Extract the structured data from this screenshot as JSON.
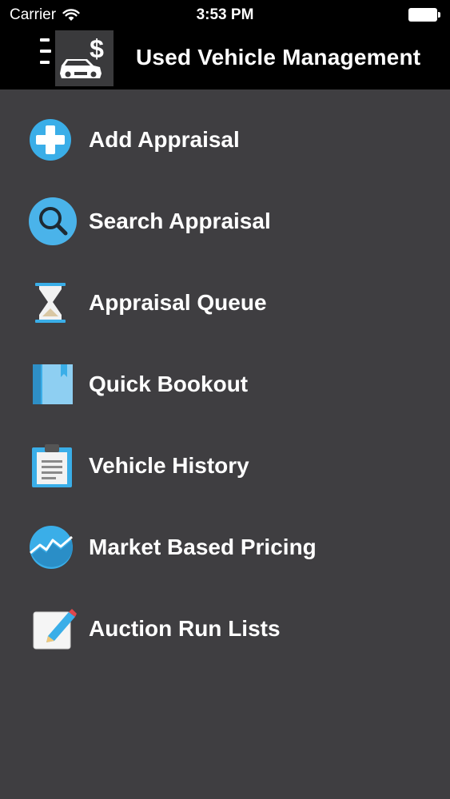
{
  "status_bar": {
    "carrier": "Carrier",
    "time": "3:53 PM"
  },
  "nav_bar": {
    "title": "Used Vehicle Management"
  },
  "menu": {
    "items": [
      {
        "label": "Add Appraisal",
        "icon": "plus-circle-icon"
      },
      {
        "label": "Search Appraisal",
        "icon": "magnifier-icon"
      },
      {
        "label": "Appraisal Queue",
        "icon": "hourglass-icon"
      },
      {
        "label": "Quick Bookout",
        "icon": "book-icon"
      },
      {
        "label": "Vehicle History",
        "icon": "clipboard-icon"
      },
      {
        "label": "Market Based Pricing",
        "icon": "market-chart-icon"
      },
      {
        "label": "Auction Run Lists",
        "icon": "pencil-note-icon"
      }
    ]
  },
  "colors": {
    "background": "#3f3e41",
    "topbar": "#000000",
    "accent_blue": "#3aaee8"
  }
}
